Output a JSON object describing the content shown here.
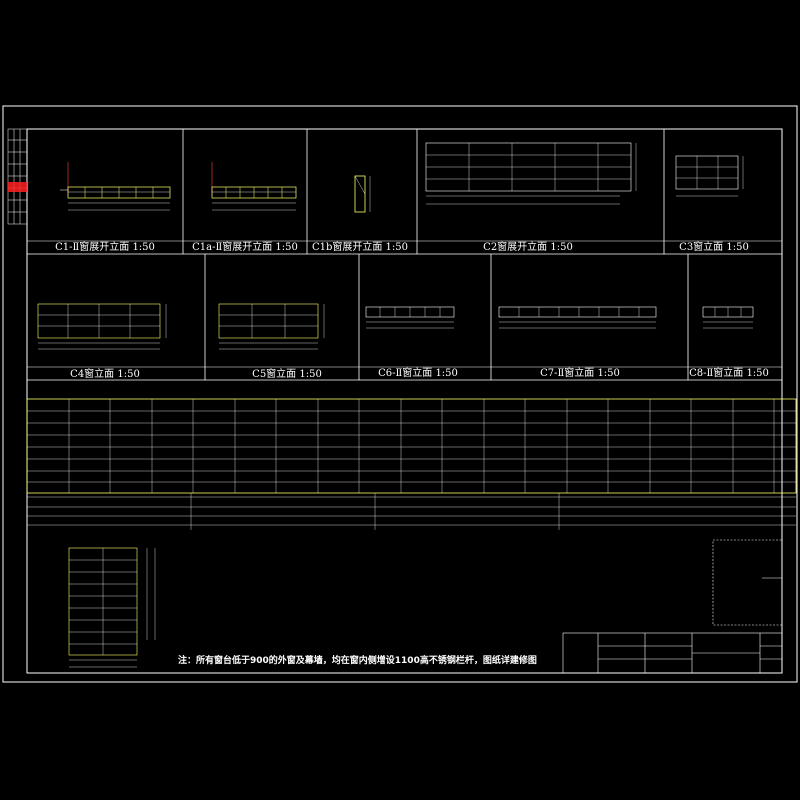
{
  "drawing": {
    "background": "#000000",
    "line_color": "#ffffff",
    "window_color": "#ffff66",
    "frame_color": "#ffffff",
    "dim_color": "#ffffff",
    "level_color": "#ffffff",
    "accent_color": "#ff2020",
    "accent_icon": "red-revision-mark"
  },
  "panels": [
    {
      "id": "c1",
      "label": "C1-Ⅱ窗展开立面 1:50"
    },
    {
      "id": "c1a",
      "label": "C1a-Ⅱ窗展开立面 1:50"
    },
    {
      "id": "c1b",
      "label": "C1b窗展开立面 1:50"
    },
    {
      "id": "c2",
      "label": "C2窗展开立面 1:50"
    },
    {
      "id": "c3",
      "label": "C3窗立面 1:50"
    },
    {
      "id": "c4",
      "label": "C4窗立面 1:50"
    },
    {
      "id": "c5",
      "label": "C5窗立面 1:50"
    },
    {
      "id": "c6",
      "label": "C6-Ⅱ窗立面 1:50"
    },
    {
      "id": "c7",
      "label": "C7-Ⅱ窗立面 1:50"
    },
    {
      "id": "c8",
      "label": "C8-Ⅱ窗立面 1:50"
    }
  ],
  "note": "注：所有窗台低于900的外窗及幕墙，均在窗内侧增设1100高不锈钢栏杆，图纸详建修图"
}
